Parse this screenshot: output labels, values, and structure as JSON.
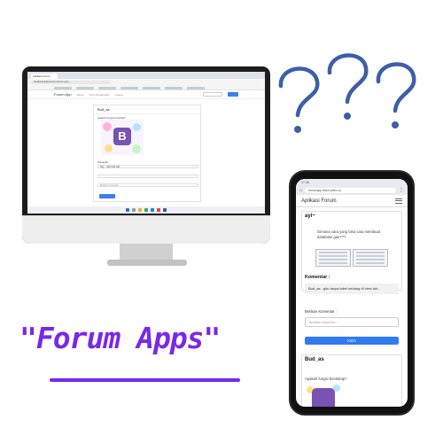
{
  "desktop": {
    "tab_title": "Aplikasi Forum",
    "url": "localhost/aplikasi-forum/forum.php",
    "site_brand": "Forum App",
    "nav_links": [
      "Home",
      "Kirim Pertanyaan",
      "Logout"
    ],
    "post_user": "Bud_as",
    "post_question": "Apakah fungsi bootstrap?",
    "comment_label": "Komentar :",
    "comment_text": "Sgt_ : Ajib baik pak",
    "reply_placeholder": "Berikan komentar"
  },
  "phone": {
    "status_time": "17:48",
    "url": "forumapp.flash.webi.co",
    "brand": "Aplikasi Forum",
    "post1_user": "ayi~",
    "post1_question": "Gimana cara yang bisa cara membuat database gan???",
    "comment_label": "Komentar :",
    "comment_text": "Bud_as : gitu tanya tabel sedang di view lah...",
    "reply_label": "Berikan Komentar :",
    "reply_placeholder": "Berikan komentar...",
    "send_label": "Kirim",
    "post2_user": "Bud_as",
    "post2_question": "Apakah fungsi bootstrap?"
  },
  "decoration": {
    "question_marks": "???",
    "question_color": "#3d5fa8"
  },
  "caption": {
    "title": "\"Forum Apps\"",
    "color": "#7a28e8"
  }
}
